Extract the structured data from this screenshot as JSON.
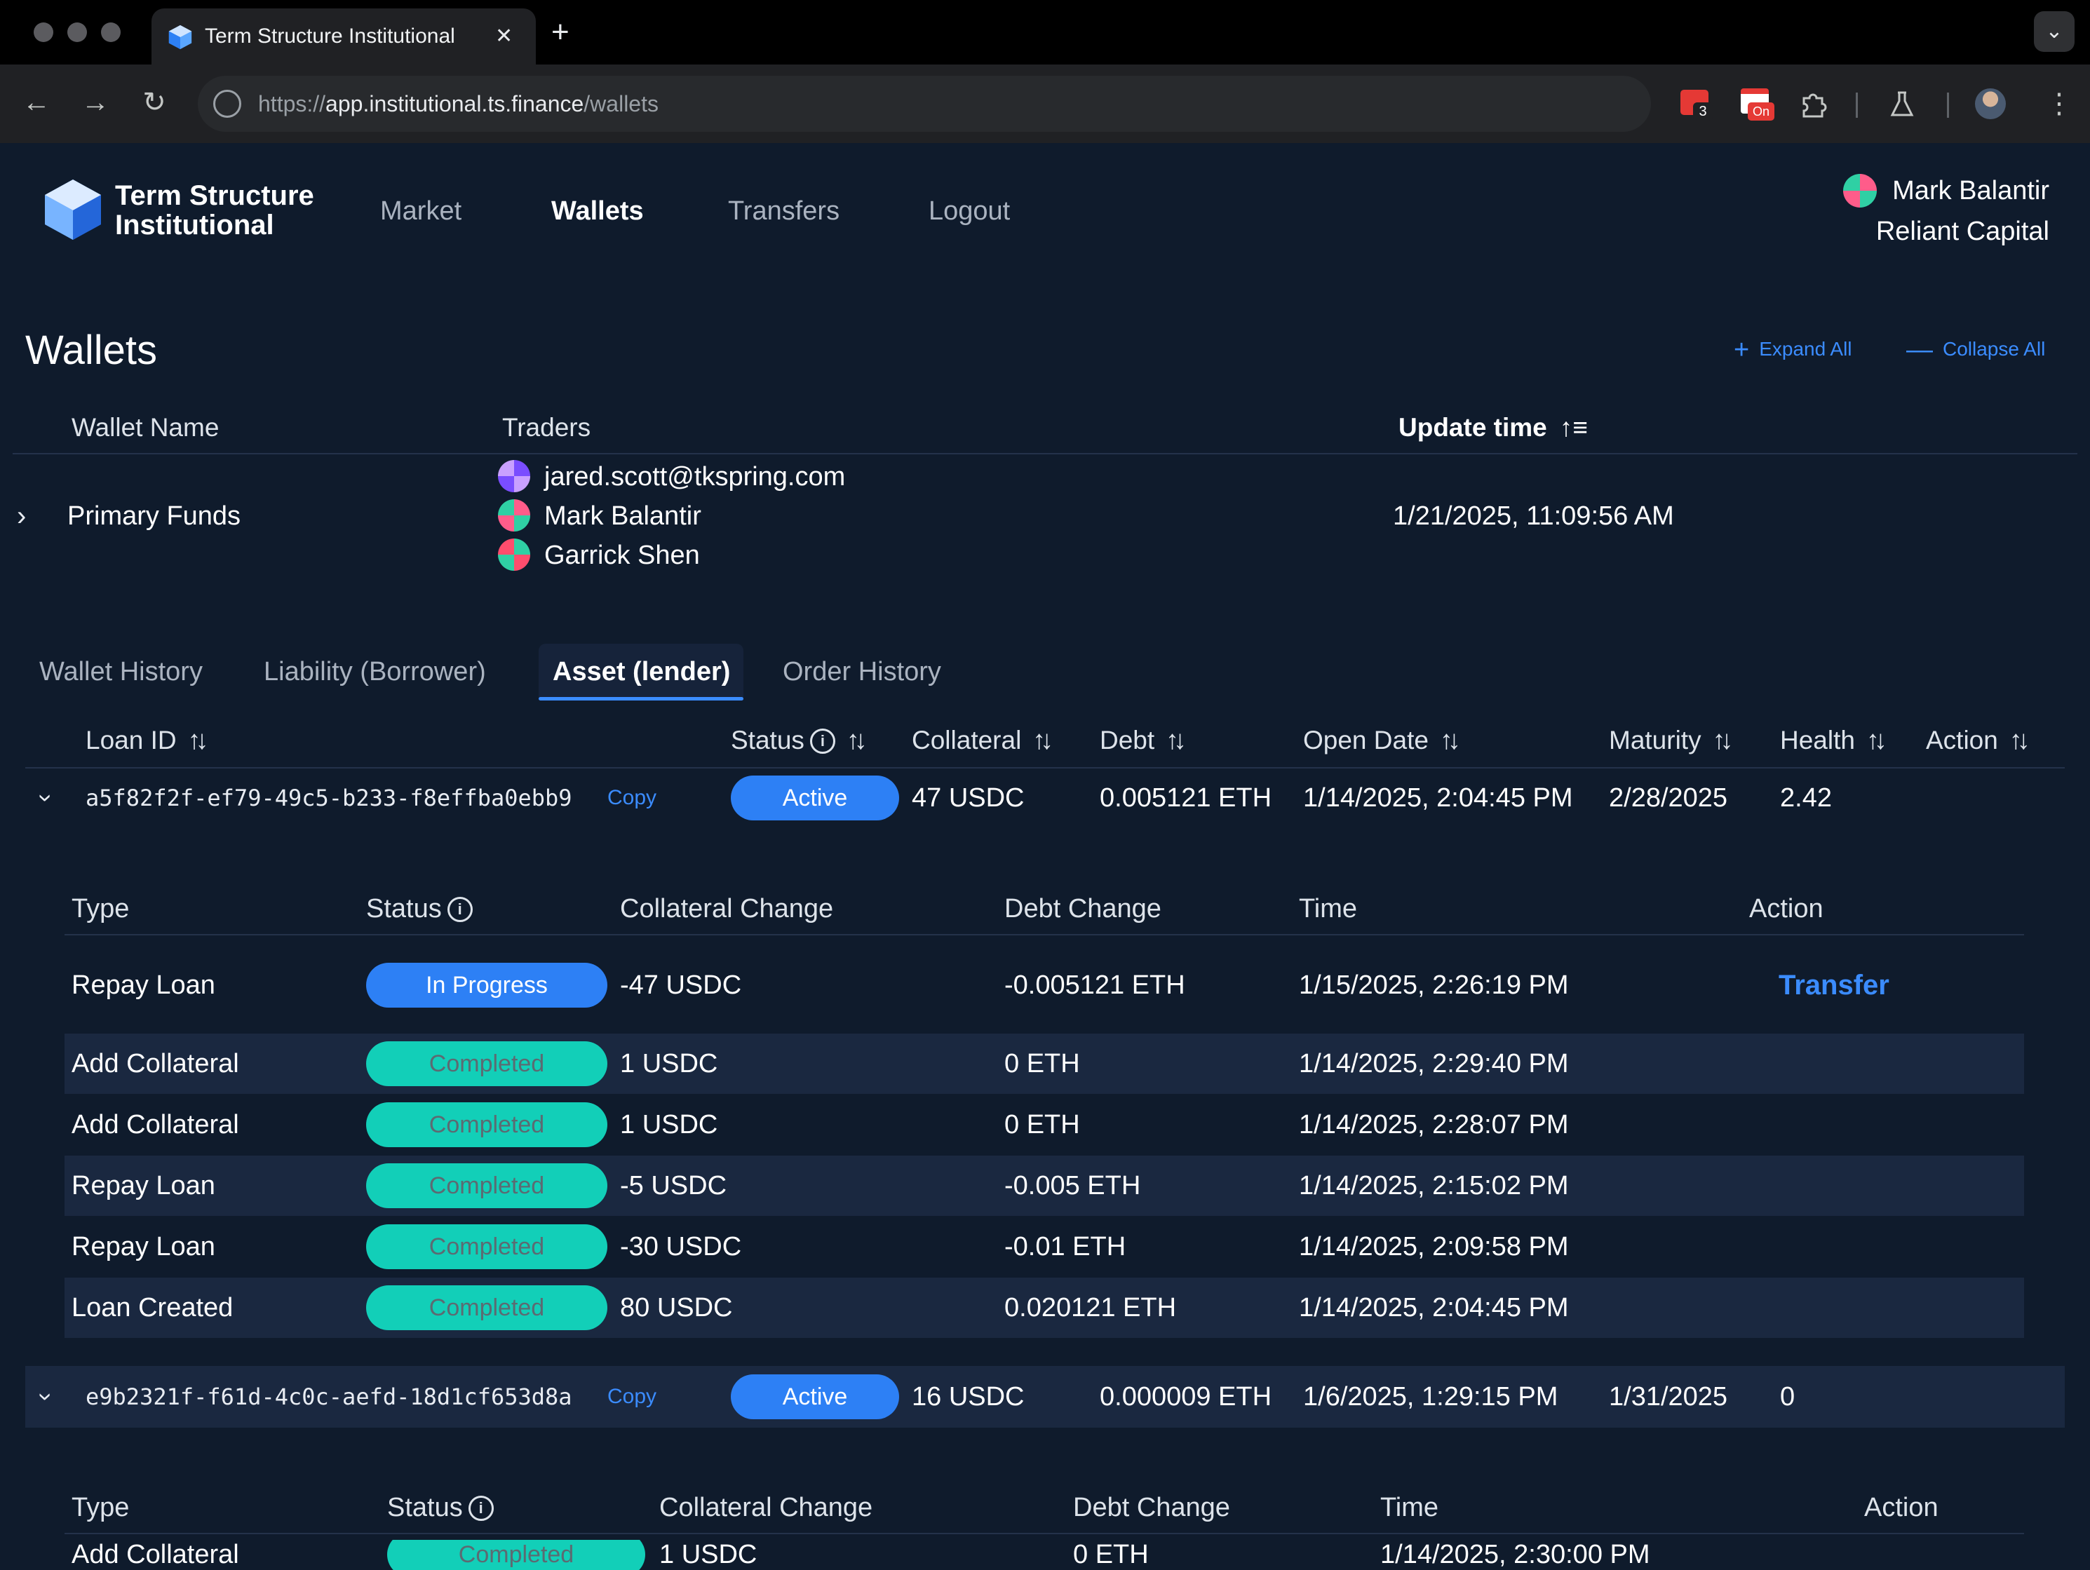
{
  "browser": {
    "tab_title": "Term Structure Institutional",
    "tab_close": "✕",
    "new_tab": "+",
    "tab_menu": "⌄",
    "back": "←",
    "forward": "→",
    "reload": "↻",
    "url_scheme": "https://",
    "url_host": "app.institutional.ts.finance",
    "url_path": "/wallets",
    "extension_badge_count": "3",
    "extension_badge_on": "On"
  },
  "header": {
    "brand_line1": "Term Structure",
    "brand_line2": "Institutional",
    "nav": [
      "Market",
      "Wallets",
      "Transfers",
      "Logout"
    ],
    "active_nav": "Wallets",
    "user_name": "Mark Balantir",
    "user_org": "Reliant Capital"
  },
  "page": {
    "title": "Wallets",
    "expand_all": "Expand All",
    "collapse_all": "Collapse All"
  },
  "wallet_table": {
    "headers": {
      "name": "Wallet Name",
      "traders": "Traders",
      "update_time": "Update time"
    },
    "row": {
      "name": "Primary Funds",
      "traders": [
        "jared.scott@tkspring.com",
        "Mark Balantir",
        "Garrick Shen"
      ],
      "update_time": "1/21/2025, 11:09:56 AM"
    }
  },
  "tabs": [
    "Wallet History",
    "Liability (Borrower)",
    "Asset (lender)",
    "Order History"
  ],
  "active_tab": "Asset (lender)",
  "loan_table": {
    "headers": [
      "Loan ID",
      "Status",
      "Collateral",
      "Debt",
      "Open Date",
      "Maturity",
      "Health",
      "Action"
    ],
    "copy_label": "Copy",
    "sub_headers": [
      "Type",
      "Status",
      "Collateral Change",
      "Debt Change",
      "Time",
      "Action"
    ],
    "loans": [
      {
        "id": "a5f82f2f-ef79-49c5-b233-f8effba0ebb9",
        "status": "Active",
        "collateral": "47 USDC",
        "debt": "0.005121 ETH",
        "open_date": "1/14/2025, 2:04:45 PM",
        "maturity": "2/28/2025",
        "health": "2.42",
        "history": [
          {
            "type": "Repay Loan",
            "status": "In Progress",
            "collateral_change": "-47 USDC",
            "debt_change": "-0.005121 ETH",
            "time": "1/15/2025, 2:26:19 PM",
            "action": "Transfer"
          },
          {
            "type": "Add Collateral",
            "status": "Completed",
            "collateral_change": "1 USDC",
            "debt_change": "0 ETH",
            "time": "1/14/2025, 2:29:40 PM",
            "action": ""
          },
          {
            "type": "Add Collateral",
            "status": "Completed",
            "collateral_change": "1 USDC",
            "debt_change": "0 ETH",
            "time": "1/14/2025, 2:28:07 PM",
            "action": ""
          },
          {
            "type": "Repay Loan",
            "status": "Completed",
            "collateral_change": "-5 USDC",
            "debt_change": "-0.005 ETH",
            "time": "1/14/2025, 2:15:02 PM",
            "action": ""
          },
          {
            "type": "Repay Loan",
            "status": "Completed",
            "collateral_change": "-30 USDC",
            "debt_change": "-0.01 ETH",
            "time": "1/14/2025, 2:09:58 PM",
            "action": ""
          },
          {
            "type": "Loan Created",
            "status": "Completed",
            "collateral_change": "80 USDC",
            "debt_change": "0.020121 ETH",
            "time": "1/14/2025, 2:04:45 PM",
            "action": ""
          }
        ]
      },
      {
        "id": "e9b2321f-f61d-4c0c-aefd-18d1cf653d8a",
        "status": "Active",
        "collateral": "16 USDC",
        "debt": "0.000009 ETH",
        "open_date": "1/6/2025, 1:29:15 PM",
        "maturity": "1/31/2025",
        "health": "0",
        "history": [
          {
            "type": "Add Collateral",
            "status": "Completed",
            "collateral_change": "1 USDC",
            "debt_change": "0 ETH",
            "time": "1/14/2025, 2:30:00 PM",
            "action": ""
          }
        ]
      }
    ]
  },
  "colors": {
    "accent": "#2d80f5",
    "completed": "#12cfb8",
    "background": "#0f1b2c",
    "stripe": "#1a2840"
  }
}
